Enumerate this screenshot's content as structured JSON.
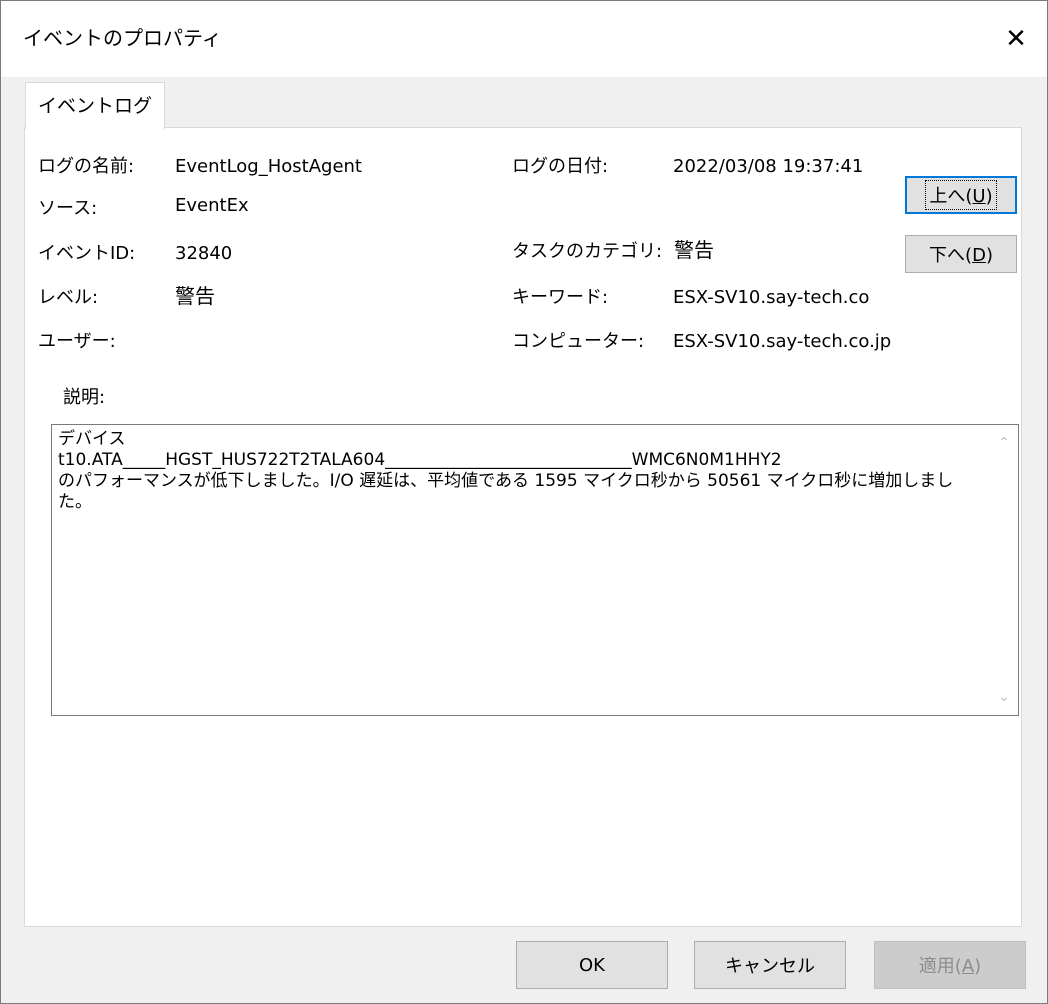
{
  "window": {
    "title": "イベントのプロパティ",
    "close_symbol": "✕"
  },
  "tabs": [
    {
      "label": "イベントログ",
      "selected": true
    }
  ],
  "fields": {
    "log_name": {
      "label": "ログの名前:",
      "value": "EventLog_HostAgent"
    },
    "source": {
      "label": "ソース:",
      "value": "EventEx"
    },
    "event_id": {
      "label": "イベントID:",
      "value": "32840"
    },
    "level": {
      "label": "レベル:",
      "value": "警告"
    },
    "user": {
      "label": "ユーザー:",
      "value": ""
    },
    "log_date": {
      "label": "ログの日付:",
      "value": "2022/03/08 19:37:41"
    },
    "task_category": {
      "label": "タスクのカテゴリ:",
      "value": "警告"
    },
    "keyword": {
      "label": "キーワード:",
      "value": "ESX-SV10.say-tech.co"
    },
    "computer": {
      "label": "コンピューター:",
      "value": "ESX-SV10.say-tech.co.jp"
    }
  },
  "nav_buttons": {
    "up": {
      "text": "上へ(",
      "key": "U",
      "tail": ")"
    },
    "down": {
      "text": "下へ(",
      "key": "D",
      "tail": ")"
    }
  },
  "description": {
    "label": "説明:",
    "text": "デバイス\nt10.ATA_____HGST_HUS722T2TALA604_____________________________WMC6N0M1HHY2\nのパフォーマンスが低下しました。I/O 遅延は、平均値である 1595 マイクロ秒から 50561 マイクロ秒に増加しました。"
  },
  "footer": {
    "ok": "OK",
    "cancel": "キャンセル",
    "apply": {
      "text": "適用(",
      "key": "A",
      "tail": ")"
    }
  }
}
